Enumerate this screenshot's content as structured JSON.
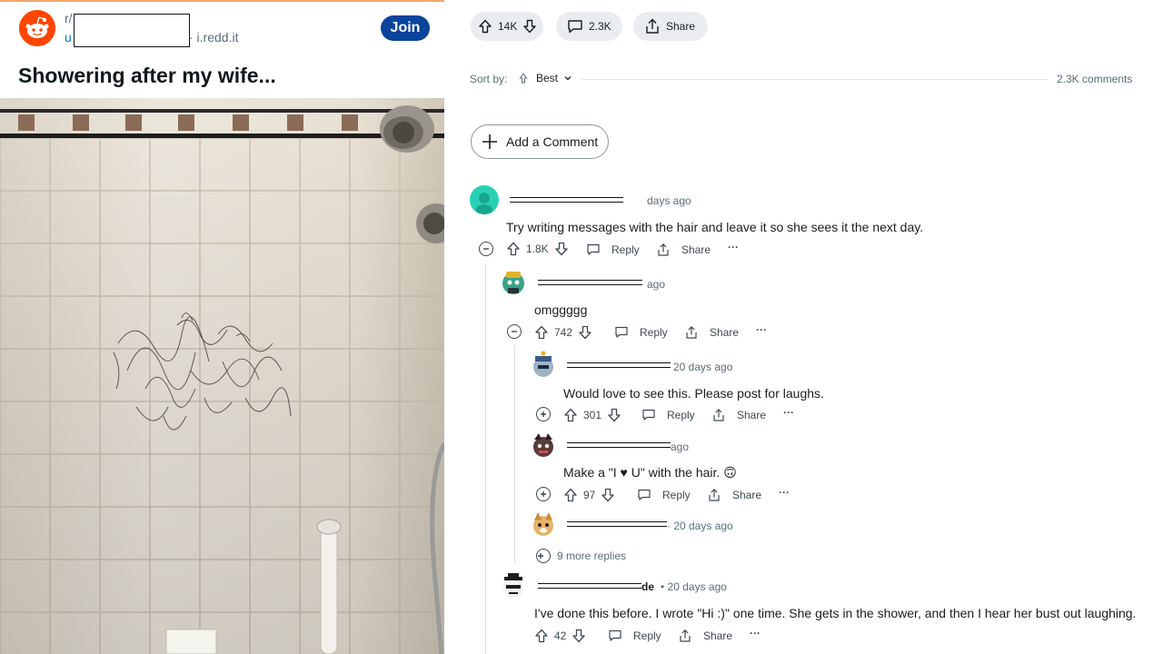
{
  "post": {
    "subreddit_prefix": "r/",
    "user_prefix": "u",
    "domain": "· i.redd.it",
    "join_label": "Join",
    "title": "Showering after my wife..."
  },
  "actions": {
    "upvotes": "14K",
    "comments": "2.3K",
    "share": "Share"
  },
  "sort": {
    "label": "Sort by:",
    "value": "Best",
    "comment_count": "2.3K comments"
  },
  "add_comment": "Add a Comment",
  "comments": [
    {
      "time": "days ago",
      "text": "Try writing messages with the hair and leave it so she sees it the next day.",
      "score": "1.8K",
      "reply": "Reply",
      "share": "Share",
      "more": "···"
    },
    {
      "time": "ago",
      "text": "omggggg",
      "score": "742",
      "reply": "Reply",
      "share": "Share",
      "more": "···"
    },
    {
      "time": "20 days ago",
      "text": "Would love to see this. Please post for laughs.",
      "score": "301",
      "reply": "Reply",
      "share": "Share",
      "more": "···"
    },
    {
      "time": "ago",
      "text": "Make a \"I ♥ U\" with the hair. 🙃",
      "score": "97",
      "reply": "Reply",
      "share": "Share",
      "more": "···"
    },
    {
      "time": "· 20 days ago"
    },
    {
      "name_suffix": "de",
      "time": "• 20 days ago",
      "text": "I've done this before. I wrote \"Hi :)\" one time. She gets in the shower, and then I hear her bust out laughing.",
      "score": "42",
      "reply": "Reply",
      "share": "Share",
      "more": "···"
    }
  ],
  "more_replies": "9 more replies",
  "colors": {
    "join": "#0a449b",
    "pill": "#eaedef",
    "reddit_orange": "#ff4500",
    "link": "#0079d3"
  },
  "icons": [
    "reddit-alien-icon",
    "upvote-icon",
    "downvote-icon",
    "comment-icon",
    "share-icon",
    "plus-icon",
    "minus-icon",
    "sort-icon",
    "chevron-down-icon",
    "reply-icon",
    "more-icon"
  ]
}
